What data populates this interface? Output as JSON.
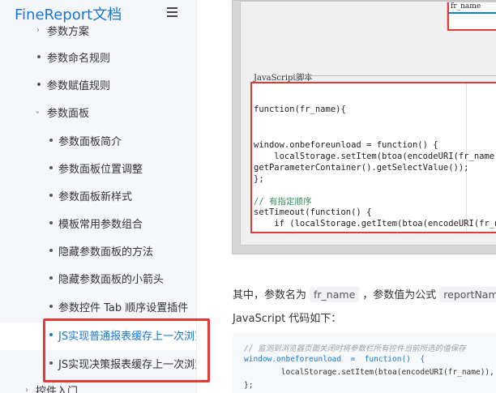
{
  "header": {
    "logo_text": "FineReport文档",
    "menu_icon": "hamburger-icon"
  },
  "sidebar": {
    "items": [
      {
        "label": "参数方案",
        "level": 1,
        "type": "chevron"
      },
      {
        "label": "参数命名规则",
        "level": 1,
        "type": "bullet"
      },
      {
        "label": "参数赋值规则",
        "level": 1,
        "type": "bullet"
      },
      {
        "label": "参数面板",
        "level": 1,
        "type": "chevron-open"
      },
      {
        "label": "参数面板简介",
        "level": 2,
        "type": "bullet"
      },
      {
        "label": "参数面板位置调整",
        "level": 2,
        "type": "bullet"
      },
      {
        "label": "参数面板新样式",
        "level": 2,
        "type": "bullet"
      },
      {
        "label": "模板常用参数组合",
        "level": 2,
        "type": "bullet"
      },
      {
        "label": "隐藏参数面板的方法",
        "level": 2,
        "type": "bullet"
      },
      {
        "label": "隐藏参数面板的小箭头",
        "level": 2,
        "type": "bullet"
      },
      {
        "label": "参数控件 Tab 顺序设置插件",
        "level": 2,
        "type": "bullet"
      },
      {
        "label": "JS实现普通报表缓存上一次浏览",
        "level": 2,
        "type": "bullet",
        "active": true
      },
      {
        "label": "JS实现决策报表缓存上一次浏览",
        "level": 2,
        "type": "bullet"
      },
      {
        "label": "控件入门",
        "level": 0,
        "type": "chevron"
      }
    ]
  },
  "screenshot": {
    "top_cell_label": "fr_name",
    "panel_title": "JavaScript脚本",
    "code": [
      "function(fr_name){",
      "",
      "",
      "window.onbeforeunload = function() {",
      "    localStorage.setItem(btoa(encodeURI(fr_name)),",
      "getParameterContainer().getSelectValue());",
      "};",
      "",
      "// 有指定顺序",
      "setTimeout(function() {",
      "    if (localStorage.getItem(btoa(encodeURI(fr_na"
    ]
  },
  "main": {
    "para_prefix": "其中，参数名为",
    "param_name": "fr_name",
    "para_mid": "，参数值为公式",
    "param_value": "reportName",
    "para_end": "。",
    "para2": "JavaScript 代码如下：",
    "snippet": [
      "// 监测到浏览器页面关闭时将参数栏所有控件当前所选的值保存",
      "window.onbeforeunload  =  function()  {",
      "        localStorage.setItem(btoa(encodeURI(fr_name)),  _g",
      "};"
    ]
  },
  "colors": {
    "accent": "#1976d2",
    "highlight_border": "#e53935",
    "sidebar_bg": "#f5f7fa"
  }
}
